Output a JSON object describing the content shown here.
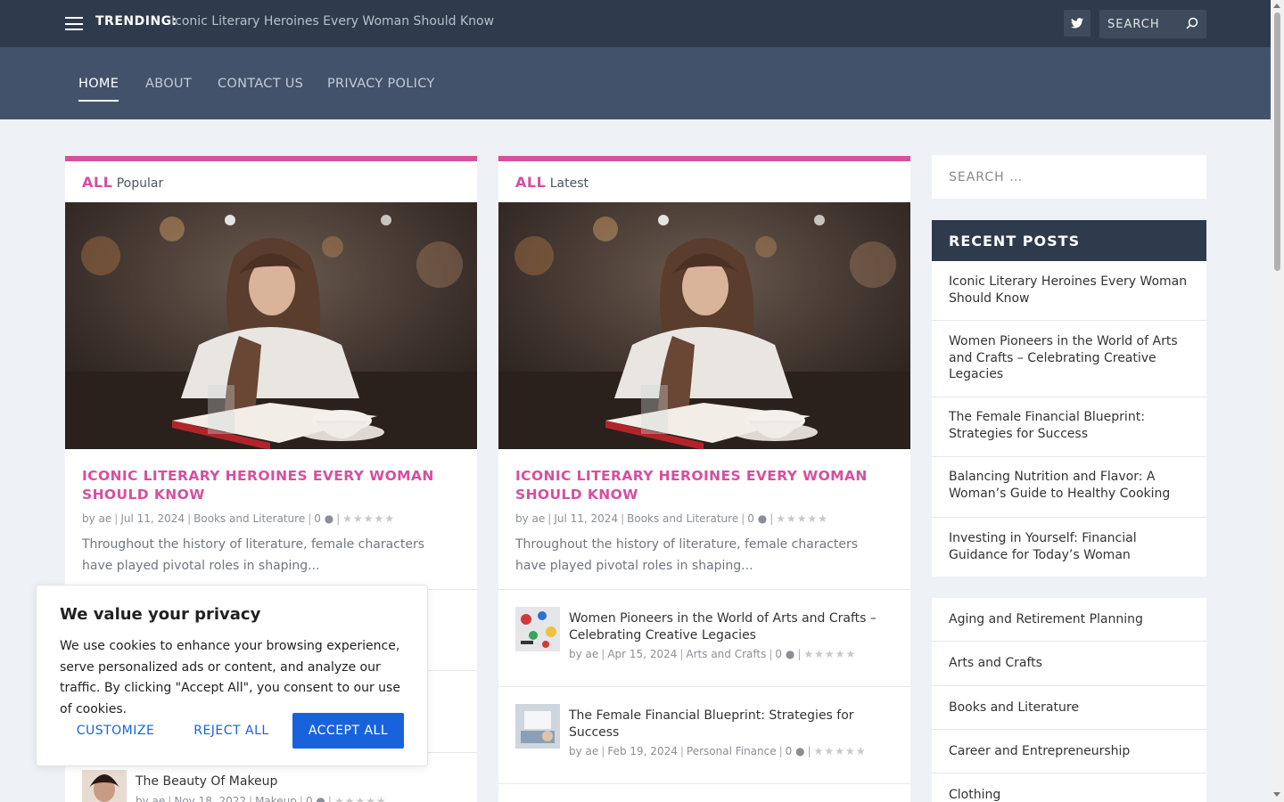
{
  "topbar": {
    "trending_label": "TRENDING:",
    "trending_text": "Iconic Literary Heroines Every Woman Should Know",
    "search_placeholder": "SEARCH"
  },
  "nav": {
    "items": [
      {
        "label": "HOME"
      },
      {
        "label": "ABOUT"
      },
      {
        "label": "CONTACT US"
      },
      {
        "label": "PRIVACY POLICY"
      }
    ]
  },
  "left_card": {
    "all": "ALL",
    "tab": "Popular",
    "featured": {
      "title": "ICONIC LITERARY HEROINES EVERY WOMAN SHOULD KNOW",
      "author": "ae",
      "date": "Jul 11, 2024",
      "category": "Books and Literature",
      "comments": "0",
      "excerpt": "Throughout the history of literature, female characters have played pivotal roles in shaping..."
    },
    "posts": [
      {
        "title": "The Beauty Of Makeup",
        "author": "ae",
        "date": "Nov 18, 2022",
        "category": "Makeup",
        "comments": "0"
      }
    ]
  },
  "right_card": {
    "all": "ALL",
    "tab": "Latest",
    "featured": {
      "title": "ICONIC LITERARY HEROINES EVERY WOMAN SHOULD KNOW",
      "author": "ae",
      "date": "Jul 11, 2024",
      "category": "Books and Literature",
      "comments": "0",
      "excerpt": "Throughout the history of literature, female characters have played pivotal roles in shaping..."
    },
    "posts": [
      {
        "title": "Women Pioneers in the World of Arts and Crafts – Celebrating Creative Legacies",
        "author": "ae",
        "date": "Apr 15, 2024",
        "category": "Arts and Crafts",
        "comments": "0"
      },
      {
        "title": "The Female Financial Blueprint: Strategies for Success",
        "author": "ae",
        "date": "Feb 19, 2024",
        "category": "Personal Finance",
        "comments": "0"
      }
    ]
  },
  "sidebar": {
    "search_placeholder": "SEARCH …",
    "recent_title": "RECENT POSTS",
    "recent_posts": [
      "Iconic Literary Heroines Every Woman Should Know",
      "Women Pioneers in the World of Arts and Crafts – Celebrating Creative Legacies",
      "The Female Financial Blueprint: Strategies for Success",
      "Balancing Nutrition and Flavor: A Woman’s Guide to Healthy Cooking",
      "Investing in Yourself: Financial Guidance for Today’s Woman"
    ],
    "categories": [
      "Aging and Retirement Planning",
      "Arts and Crafts",
      "Books and Literature",
      "Career and Entrepreneurship",
      "Clothing"
    ]
  },
  "cookie": {
    "title": "We value your privacy",
    "text": "We use cookies to enhance your browsing experience, serve personalized ads or content, and analyze our traffic. By clicking \"Accept All\", you consent to our use of cookies.",
    "customize": "CUSTOMIZE",
    "reject": "REJECT ALL",
    "accept": "ACCEPT ALL"
  },
  "colors": {
    "accent": "#d64fa0",
    "topbar": "#2d3b4c",
    "navbar": "#42526a",
    "cookie_button": "#1863dc"
  }
}
